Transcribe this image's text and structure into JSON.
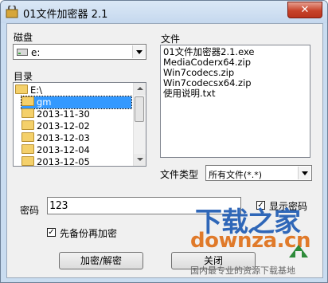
{
  "window": {
    "title": "01文件加密器 2.1",
    "close_glyph": "✕"
  },
  "disk": {
    "label": "磁盘",
    "selected": "e:",
    "icon": "drive-icon"
  },
  "directory": {
    "label": "目录",
    "items": [
      "E:\\",
      "gm",
      "2013-11-30",
      "2013-12-02",
      "2013-12-03",
      "2013-12-04",
      "2013-12-05"
    ],
    "selected_index": 1
  },
  "files": {
    "label": "文件",
    "items": [
      "01文件加密器2.1.exe",
      "MediaCoderx64.zip",
      "Win7codecs.zip",
      "Win7codecsx64.zip",
      "使用说明.txt"
    ]
  },
  "file_type": {
    "label": "文件类型",
    "selected": "所有文件(*.*)"
  },
  "password": {
    "label": "密码",
    "value": "123"
  },
  "show_password": {
    "label": "显示密码",
    "checked": true
  },
  "backup_before_encrypt": {
    "label": "先备份再加密",
    "checked": true
  },
  "buttons": {
    "encrypt_decrypt": "加密/解密",
    "close": "关闭"
  },
  "watermark": {
    "logo": "下载之家",
    "url": "downza.cn",
    "slogan": "国内最专业的资源下载基地"
  },
  "colors": {
    "titlebar": "#c5d8ee",
    "selection": "#3399ff",
    "close_button": "#c7432a",
    "watermark_blue": "#2f67b8",
    "watermark_orange": "#e07a2a"
  }
}
